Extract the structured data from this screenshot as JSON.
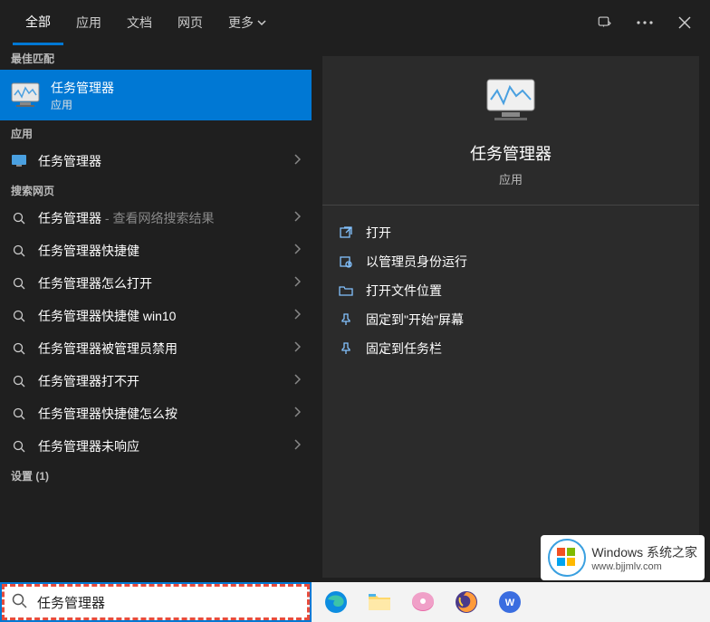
{
  "tabs": {
    "all": "全部",
    "apps": "应用",
    "docs": "文档",
    "web": "网页",
    "more": "更多"
  },
  "sections": {
    "best": "最佳匹配",
    "apps": "应用",
    "searchweb": "搜索网页",
    "settings": "设置 (1)"
  },
  "best_match": {
    "title": "任务管理器",
    "subtitle": "应用"
  },
  "apps_list": [
    {
      "label": "任务管理器"
    }
  ],
  "web_suffix": " - 查看网络搜索结果",
  "web_list": [
    {
      "label": "任务管理器",
      "has_suffix": true
    },
    {
      "label": "任务管理器快捷健"
    },
    {
      "label": "任务管理器怎么打开"
    },
    {
      "label": "任务管理器快捷健 win10"
    },
    {
      "label": "任务管理器被管理员禁用"
    },
    {
      "label": "任务管理器打不开"
    },
    {
      "label": "任务管理器快捷健怎么按"
    },
    {
      "label": "任务管理器未响应"
    }
  ],
  "preview": {
    "title": "任务管理器",
    "subtitle": "应用"
  },
  "actions": [
    {
      "icon": "open",
      "label": "打开"
    },
    {
      "icon": "admin",
      "label": "以管理员身份运行"
    },
    {
      "icon": "folder",
      "label": "打开文件位置"
    },
    {
      "icon": "pin",
      "label": "固定到\"开始\"屏幕"
    },
    {
      "icon": "pin",
      "label": "固定到任务栏"
    }
  ],
  "search": {
    "value": "任务管理器"
  },
  "watermark": {
    "line1": "Windows 系统之家",
    "line2": "www.bjjmlv.com"
  }
}
